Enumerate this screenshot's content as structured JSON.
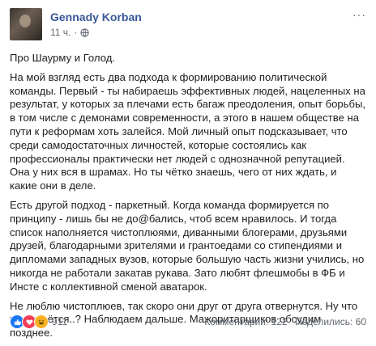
{
  "post": {
    "author": "Gennady Korban",
    "time": "11 ч.",
    "separator": "·",
    "more_label": "···",
    "paragraphs": [
      "Про Шаурму и Голод.",
      "На мой взгляд есть два подхода к формированию политической команды. Первый - ты набираешь эффективных людей, нацеленных на результат, у которых за плечами есть багаж преодоления, опыт борьбы, в том числе с демонами современности, а этого в нашем обществе на пути к реформам хоть залейся. Мой личный опыт подсказывает, что среди самодостаточных личностей, которые состоялись как профессионалы практически нет людей с однозначной репутацией. Она у них вся в шрамах. Но ты чётко знаешь, чего от них ждать, и какие они в деле.",
      "Есть другой подход - паркетный. Когда команда формируется по принципу - лишь бы не до@бались, чтоб всем нравилось. И тогда список наполняется чистоплюями, диванными блогерами, друзьями друзей, благодарными зрителями и грантоедами со стипендиями и дипломами западных вузов, которые большую часть жизни учились, но никогда не работали закатав рукава. Зато любят флешмобы в ФБ и Инсте с коллективной сменой аватарок.",
      "Не люблю чистоплюев, так скоро они друг от друга отвернутся. Ну что же остаётся..? Наблюдаем дальше. Мажоритарщиков обсудим позднее."
    ],
    "reactions": {
      "count": "911",
      "types": [
        "like",
        "love",
        "haha"
      ]
    },
    "comments": "Комментарии: 122",
    "shares": "Поделились: 60"
  }
}
